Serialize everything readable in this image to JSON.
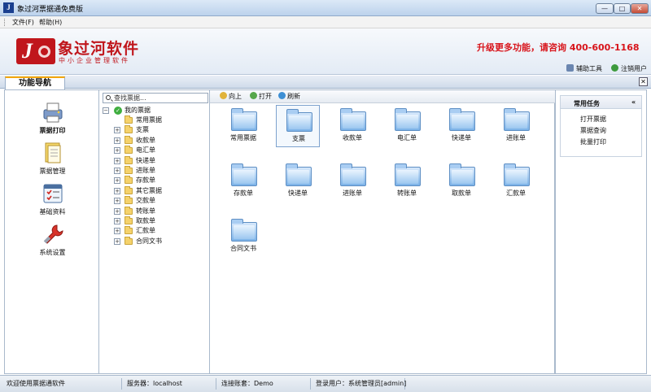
{
  "window": {
    "title": "象过河票据通免费版",
    "app_glyph": "J",
    "min_glyph": "—",
    "max_glyph": "□",
    "close_glyph": "✕"
  },
  "menu": {
    "file": "文件(F)",
    "help": "帮助(H)"
  },
  "banner": {
    "brand_name": "象过河软件",
    "brand_sub": "中小企业管理软件",
    "promo": "升级更多功能，请咨询 400-600-1168",
    "tools": "辅助工具",
    "logout": "注销用户"
  },
  "nav": {
    "tab_label": "功能导航",
    "items": [
      {
        "label": "票据打印",
        "icon": "printer-icon"
      },
      {
        "label": "票据管理",
        "icon": "document-icon"
      },
      {
        "label": "基础资料",
        "icon": "checklist-icon"
      },
      {
        "label": "系统设置",
        "icon": "wrench-icon"
      }
    ]
  },
  "tree": {
    "search_placeholder": "查找票据...",
    "root": "我的票据",
    "items": [
      "常用票据",
      "支票",
      "收款单",
      "电汇单",
      "快递单",
      "进账单",
      "存款单",
      "其它票据",
      "交款单",
      "转账单",
      "取款单",
      "汇款单",
      "合同文书"
    ]
  },
  "toolbar": {
    "up": "向上",
    "open": "打开",
    "refresh": "刷新"
  },
  "folders": [
    "常用票据",
    "支票",
    "收款单",
    "电汇单",
    "快递单",
    "进账单",
    "存款单",
    "快递单",
    "进账单",
    "转账单",
    "取款单",
    "汇款单",
    "合同文书"
  ],
  "tasks": {
    "title": "常用任务",
    "collapse": "«",
    "links": [
      "打开票据",
      "票据查询",
      "批量打印"
    ]
  },
  "status": {
    "welcome": "欢迎使用票据通软件",
    "server": "服务器：localhost",
    "account": "连接账套：Demo",
    "user": "登录用户：系统管理员[admin]"
  },
  "colors": {
    "brand_red": "#c0161c",
    "accent_orange": "#f3a600",
    "folder_blue": "#7cb2e8"
  }
}
